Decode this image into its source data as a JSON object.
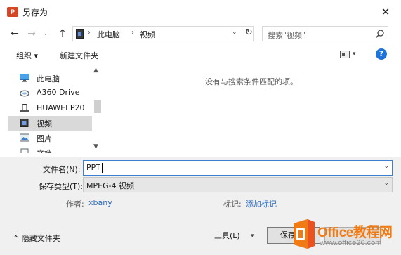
{
  "window": {
    "app_icon": "P",
    "title": "另存为",
    "close": "✕"
  },
  "nav": {
    "back": "←",
    "forward": "→",
    "recent": "⌄",
    "up": "↑"
  },
  "address": {
    "sep": "›",
    "crumbs": [
      "此电脑",
      "视频"
    ],
    "dropdown": "⌄",
    "refresh": "↻"
  },
  "search": {
    "placeholder": "搜索\"视频\""
  },
  "toolbar": {
    "organize": "组织 ▾",
    "new_folder": "新建文件夹",
    "view_dropdown": "▾",
    "help": "?"
  },
  "sidebar": {
    "items": [
      {
        "label": "此电脑",
        "icon": "computer-icon",
        "selected": false
      },
      {
        "label": "A360 Drive",
        "icon": "cloud-drive-icon",
        "selected": false
      },
      {
        "label": "HUAWEI P20",
        "icon": "phone-icon",
        "selected": false
      },
      {
        "label": "视频",
        "icon": "video-folder-icon",
        "selected": true
      },
      {
        "label": "图片",
        "icon": "pictures-folder-icon",
        "selected": false
      },
      {
        "label": "文档",
        "icon": "documents-folder-icon",
        "selected": false
      }
    ],
    "scroll_up": "▲",
    "scroll_down": "▼"
  },
  "file_list": {
    "empty_message": "没有与搜索条件匹配的项。"
  },
  "form": {
    "filename_label": "文件名(N):",
    "filename_value": "PPT",
    "filetype_label": "保存类型(T):",
    "filetype_value": "MPEG-4 视频",
    "author_label": "作者:",
    "author_value": "xbany",
    "tags_label": "标记:",
    "tags_value": "添加标记",
    "dropdown": "⌄"
  },
  "footer": {
    "hide_folders": "⌃ 隐藏文件夹",
    "tools": "工具(L)",
    "tools_dropdown": "▾",
    "save": "保存(S)"
  },
  "watermark": {
    "line1": "Office教程网",
    "line2": "www.office26.com"
  },
  "colors": {
    "accent": "#1e73d8",
    "app_icon": "#d24726",
    "watermark_orange": "#f07b14",
    "selected_row": "#d9d9d9"
  }
}
